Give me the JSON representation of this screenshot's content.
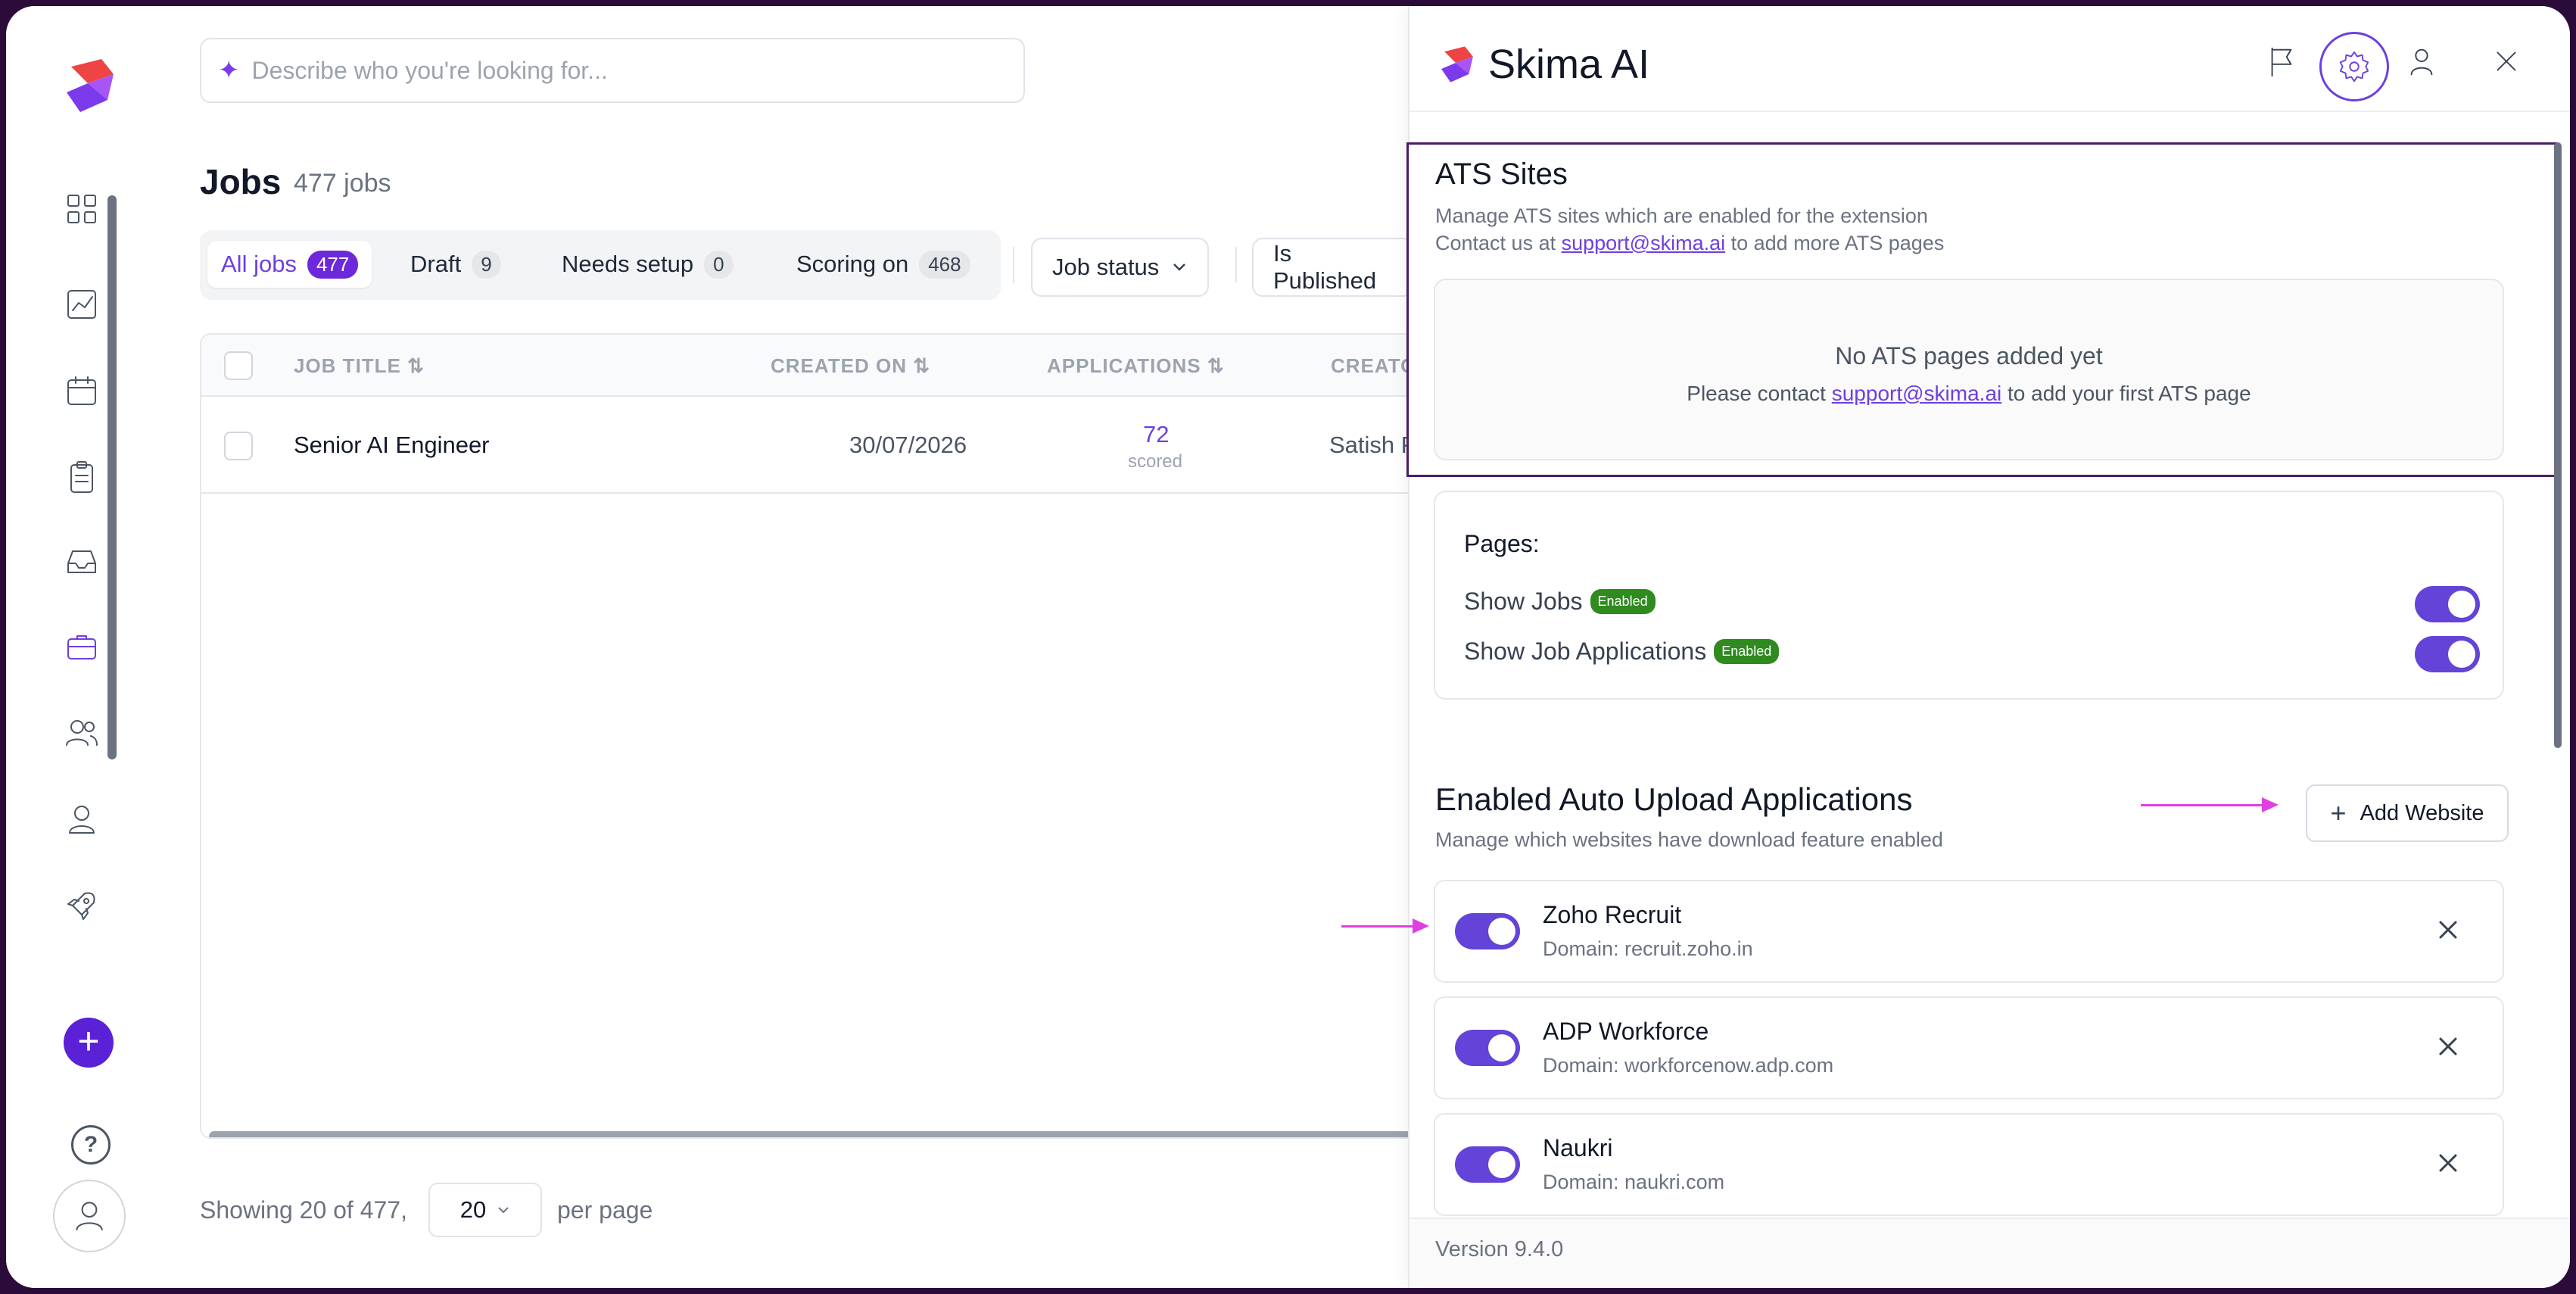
{
  "search": {
    "placeholder": "Describe who you're looking for..."
  },
  "jobs": {
    "title": "Jobs",
    "count": "477 jobs"
  },
  "tabs": [
    {
      "label": "All jobs",
      "count": "477"
    },
    {
      "label": "Draft",
      "count": "9"
    },
    {
      "label": "Needs setup",
      "count": "0"
    },
    {
      "label": "Scoring on",
      "count": "468"
    }
  ],
  "filters": {
    "job_status": "Job status",
    "is_published": "Is Published"
  },
  "table": {
    "headers": [
      "JOB TITLE",
      "CREATED ON",
      "APPLICATIONS",
      "CREATO"
    ],
    "rows": [
      {
        "title": "Senior AI Engineer",
        "created": "30/07/2026",
        "applications": "72",
        "applications_sub": "scored",
        "creator": "Satish Pr"
      }
    ]
  },
  "pagination": {
    "showing": "Showing 20 of 477,",
    "per_page_value": "20",
    "per_page_label": "per page"
  },
  "panel": {
    "brand": "Skima AI",
    "ats": {
      "title": "ATS Sites",
      "desc": "Manage ATS sites which are enabled for the extension",
      "contact_prefix": "Contact us at",
      "email": "support@skima.ai",
      "contact_suffix": "to add more ATS pages",
      "empty_title": "No ATS pages added yet",
      "empty_prefix": "Please contact",
      "empty_suffix": "to add your first ATS page"
    },
    "pages": {
      "label": "Pages:",
      "items": [
        {
          "label": "Show Jobs",
          "badge": "Enabled",
          "enabled": true
        },
        {
          "label": "Show Job Applications",
          "badge": "Enabled",
          "enabled": true
        }
      ]
    },
    "auto_upload": {
      "title": "Enabled Auto Upload Applications",
      "desc": "Manage which websites have download feature enabled",
      "add_button": "Add Website",
      "sites": [
        {
          "name": "Zoho Recruit",
          "domain": "Domain: recruit.zoho.in",
          "enabled": true
        },
        {
          "name": "ADP Workforce",
          "domain": "Domain: workforcenow.adp.com",
          "enabled": true
        },
        {
          "name": "Naukri",
          "domain": "Domain: naukri.com",
          "enabled": true
        }
      ]
    },
    "version": "Version 9.4.0"
  },
  "colors": {
    "accent": "#6d3fe0",
    "badge_green": "#2f8a1f",
    "annotation": "#e040e0",
    "highlight_border": "#4c1d65"
  }
}
